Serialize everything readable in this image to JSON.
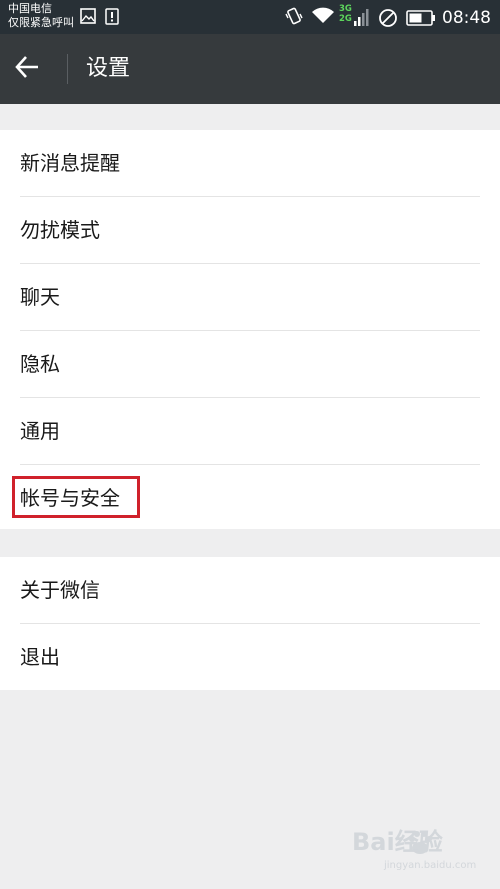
{
  "status_bar": {
    "carrier_line1": "中国电信",
    "carrier_line2": "仅限紧急呼叫",
    "network_top": "3G",
    "network_bottom": "2G",
    "time": "08:48",
    "icons": [
      "image-icon",
      "sim-icon",
      "vibrate-icon",
      "wifi-icon",
      "signal-icon",
      "no-service-icon",
      "battery-icon"
    ]
  },
  "toolbar": {
    "back_icon": "arrow-left-icon",
    "title": "设置"
  },
  "settings": {
    "group1": [
      {
        "label": "新消息提醒"
      },
      {
        "label": "勿扰模式"
      },
      {
        "label": "聊天"
      },
      {
        "label": "隐私"
      },
      {
        "label": "通用"
      },
      {
        "label": "帐号与安全"
      }
    ],
    "group2": [
      {
        "label": "关于微信"
      },
      {
        "label": "退出"
      }
    ]
  },
  "annotation": {
    "highlight_color": "#d0212b",
    "highlighted_item": "帐号与安全"
  },
  "watermark": {
    "text": "Bai经验",
    "sub": "jingyan.baidu.com"
  },
  "colors": {
    "status_bar": "#283036",
    "toolbar": "#363a3d",
    "background": "#eeeeef",
    "network_green": "#5cd45c"
  }
}
